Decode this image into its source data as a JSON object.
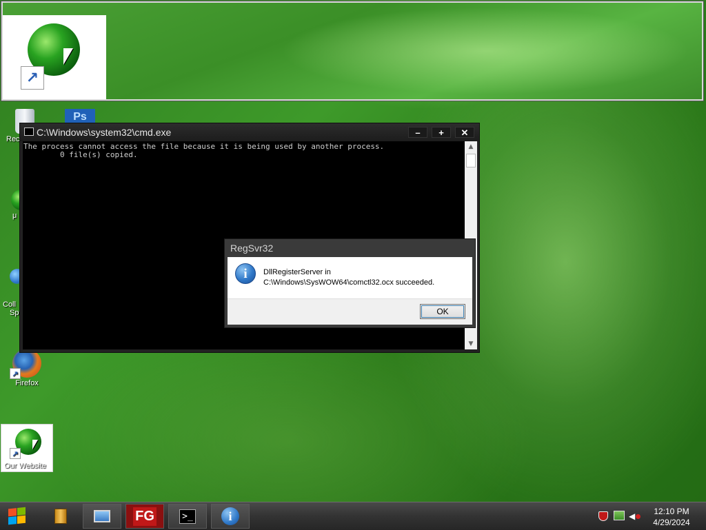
{
  "cmd_window": {
    "title": "C:\\Windows\\system32\\cmd.exe",
    "minimize_label": "–",
    "maximize_label": "+",
    "close_label": "✕",
    "output_line_1": "The process cannot access the file because it is being used by another process.",
    "output_line_2": "        0 file(s) copied."
  },
  "dialog": {
    "title": "RegSvr32",
    "message_line_1": "DllRegisterServer in",
    "message_line_2": "C:\\Windows\\SysWOW64\\comctl32.ocx succeeded.",
    "ok_label": "OK",
    "icon": "info-icon"
  },
  "desktop_icons": {
    "recycle_partial": "Rec",
    "arabic_partial": "μ",
    "coll_partial_1": "Coll",
    "coll_partial_2": "Sp",
    "firefox": "Firefox",
    "our_website": "Our Website"
  },
  "taskbar": {
    "fg_label": "FG",
    "cmd_label": ">_",
    "info_label": "i",
    "clock_time": "12:10 PM",
    "clock_date": "4/29/2024"
  },
  "colors": {
    "desktop_green": "#3e9a2a",
    "console_bg": "#000000",
    "taskbar_bg": "#333333",
    "fg_red": "#b01515"
  }
}
